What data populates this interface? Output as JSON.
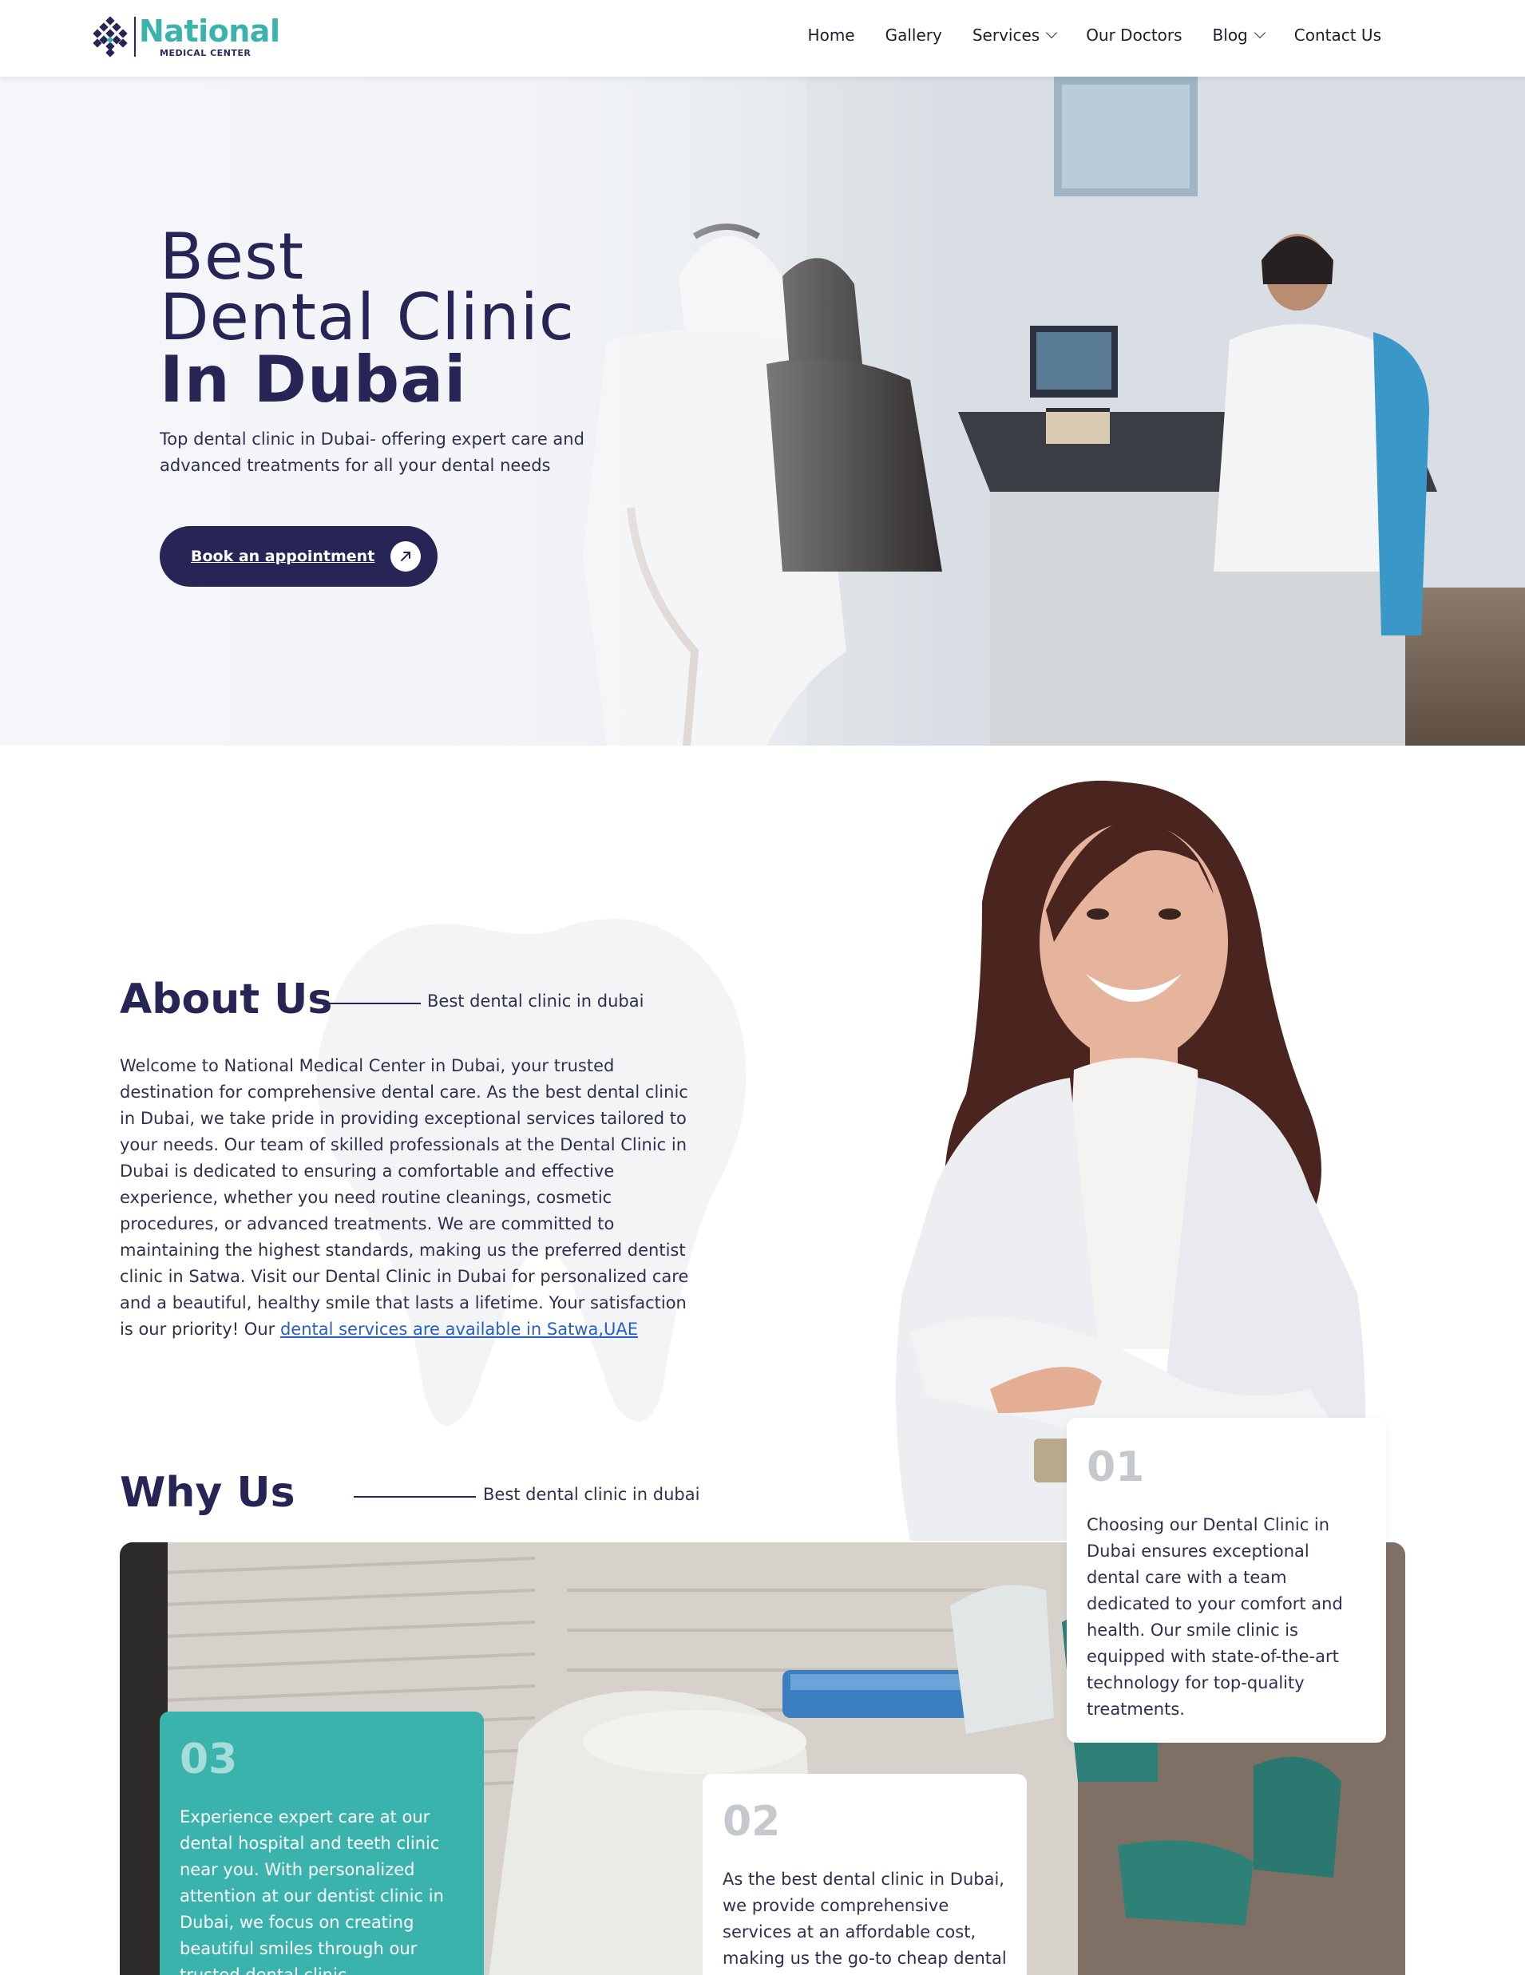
{
  "brand": {
    "name": "National",
    "subtitle": "MEDICAL CENTER",
    "colors": {
      "navy": "#272556",
      "teal": "#3bb3ad",
      "link": "#2660c4"
    }
  },
  "nav": {
    "items": [
      {
        "label": "Home",
        "dropdown": false
      },
      {
        "label": "Gallery",
        "dropdown": false
      },
      {
        "label": "Services",
        "dropdown": true
      },
      {
        "label": "Our Doctors",
        "dropdown": false
      },
      {
        "label": "Blog",
        "dropdown": true
      },
      {
        "label": "Contact Us",
        "dropdown": false
      }
    ]
  },
  "hero": {
    "title_line1": "Best",
    "title_line2": "Dental Clinic",
    "title_line3": "In Dubai",
    "subtitle": "Top dental clinic in Dubai- offering expert care and advanced treatments for all your dental needs",
    "cta_label": "Book an appointment",
    "cta_icon": "arrow-up-right-icon"
  },
  "about": {
    "title": "About Us",
    "tagline": "Best dental clinic in dubai",
    "body": "Welcome to National Medical Center in Dubai, your trusted destination for comprehensive dental care. As the best dental clinic in Dubai, we take pride in providing exceptional services tailored to your needs. Our team of skilled professionals at the Dental Clinic in Dubai is dedicated to ensuring a comfortable and effective experience, whether you need routine cleanings, cosmetic procedures, or advanced treatments. We are committed to maintaining the highest standards, making us the preferred dentist clinic in Satwa. Visit our Dental Clinic in Dubai for personalized care and a beautiful, healthy smile that lasts a lifetime. Your satisfaction is our priority! Our ",
    "link_text": "dental services are available in Satwa,UAE"
  },
  "why": {
    "title": "Why Us",
    "tagline": "Best dental clinic in dubai",
    "cards": [
      {
        "number": "01",
        "text": "Choosing our Dental Clinic in Dubai ensures exceptional dental care with a team dedicated to your comfort and health. Our smile clinic is equipped with state-of-the-art technology for top-quality treatments."
      },
      {
        "number": "02",
        "text": "As the best dental clinic in Dubai, we provide comprehensive services at an affordable cost, making us the go-to cheap dental"
      },
      {
        "number": "03",
        "text": "Experience expert care at our dental hospital and teeth clinic near you. With personalized attention at our dentist clinic in Dubai, we focus on creating beautiful smiles through our trusted dental clinic."
      }
    ]
  }
}
